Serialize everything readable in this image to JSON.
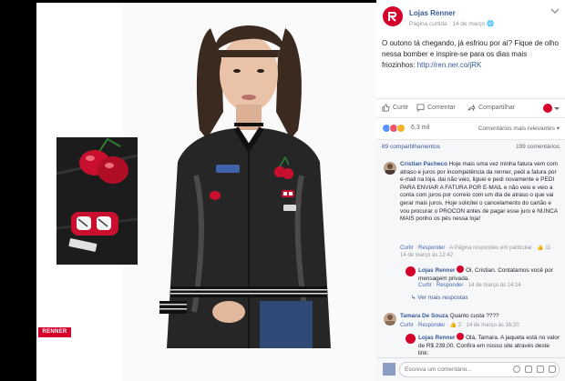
{
  "photo": {
    "brand_logo": "RENNER",
    "colors": {
      "jacket": "#2a2a2a",
      "cherry": "#c8102e",
      "brand": "#d4002b"
    }
  },
  "post": {
    "page_name": "Lojas Renner",
    "meta_liked": "Página curtida",
    "meta_separator": "·",
    "meta_date": "14 de março",
    "text": "O outono tá chegando, já esfriou por aí? Fique de olho nessa bomber e inspire-se para os dias mais friozinhos: ",
    "link": "http://ren.ner.co/jRK"
  },
  "actions": {
    "like": "Curtir",
    "comment": "Comentar",
    "share": "Compartilhar"
  },
  "reactions": {
    "count": "6,3 mil",
    "sort": "Comentários mais relevantes ▾"
  },
  "stats": {
    "shares": "69 compartilhamentos",
    "comments": "199 comentários"
  },
  "comments": [
    {
      "name": "Cristian Pacheco",
      "text": "Hoje mais uma vez minha fatura vem com atraso e juros por incompetência da renner, pedi a fatura por e-mail na loja, dai não veio, liguei e pedi novamente e PEDI PARA ENVIAR A FATURA POR E-MAIL e não veio e veio a conta com juros por correio com um dia de atraso o que vai gerar mais juros. Hoje solicitei o cancelamento do cartão e vou procurar o PROCON antes de pagar esse juro e NUNCA MAIS ponho os pés nessa loja!",
      "like": "Curtir",
      "reply": "Responder",
      "replied_note": "A Página respondeu em particular",
      "likes": "11",
      "date": "14 de março às 12:42"
    },
    {
      "name": "Lojas Renner",
      "text": "Oi, Cristian. Contatamos você por mensagem privada.",
      "like": "Curtir",
      "reply": "Responder",
      "date": "14 de março às 14:14"
    },
    {
      "more_replies": "Ver mais respostas"
    },
    {
      "name": "Tamara De Souza",
      "text": "Quanto custa ????",
      "like": "Curtir",
      "reply": "Responder",
      "likes": "2",
      "date": "14 de março às 16:20"
    },
    {
      "name": "Lojas Renner",
      "text": "Olá, Tamara. A jaqueta está no valor de R$ 239,00. Confira em nosso site através deste link:",
      "like": "",
      "reply": "",
      "date": ""
    }
  ],
  "composer": {
    "placeholder": "Escreva um comentário..."
  }
}
